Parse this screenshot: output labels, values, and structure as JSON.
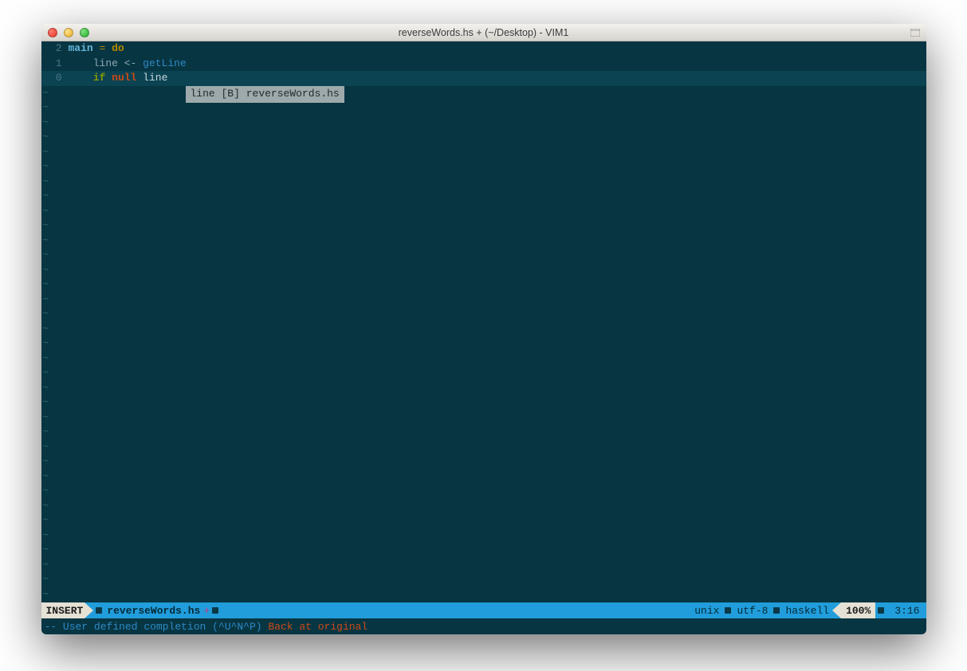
{
  "window": {
    "title": "reverseWords.hs + (~/Desktop) - VIM1"
  },
  "buffer": {
    "lines": [
      {
        "gutter": "2",
        "tokens": [
          {
            "t": "main",
            "c": "kw-main"
          },
          {
            "t": " = ",
            "c": "op"
          },
          {
            "t": "do",
            "c": "kw-do"
          }
        ],
        "current": false
      },
      {
        "gutter": "1",
        "tokens": [
          {
            "t": "    ",
            "c": ""
          },
          {
            "t": "line",
            "c": "ident"
          },
          {
            "t": " <- ",
            "c": "ident"
          },
          {
            "t": "getLine",
            "c": "func"
          }
        ],
        "current": false
      },
      {
        "gutter": "0",
        "tokens": [
          {
            "t": "    ",
            "c": ""
          },
          {
            "t": "if",
            "c": "kw-if"
          },
          {
            "t": " ",
            "c": ""
          },
          {
            "t": "null",
            "c": "kw-null"
          },
          {
            "t": " ",
            "c": ""
          },
          {
            "t": "line",
            "c": "hl"
          }
        ],
        "current": true
      }
    ],
    "tilde": "~",
    "tilde_count": 35
  },
  "completion_popup": "line [B] reverseWords.hs",
  "statusline": {
    "mode": "INSERT",
    "filename": "reverseWords.hs",
    "modified": "+",
    "fileformat": "unix",
    "encoding": "utf-8",
    "filetype": "haskell",
    "percent": "100%",
    "position": "3:16"
  },
  "cmdline": {
    "prefix": "-- User defined completion (^U^N^P) ",
    "msg": "Back at original"
  }
}
